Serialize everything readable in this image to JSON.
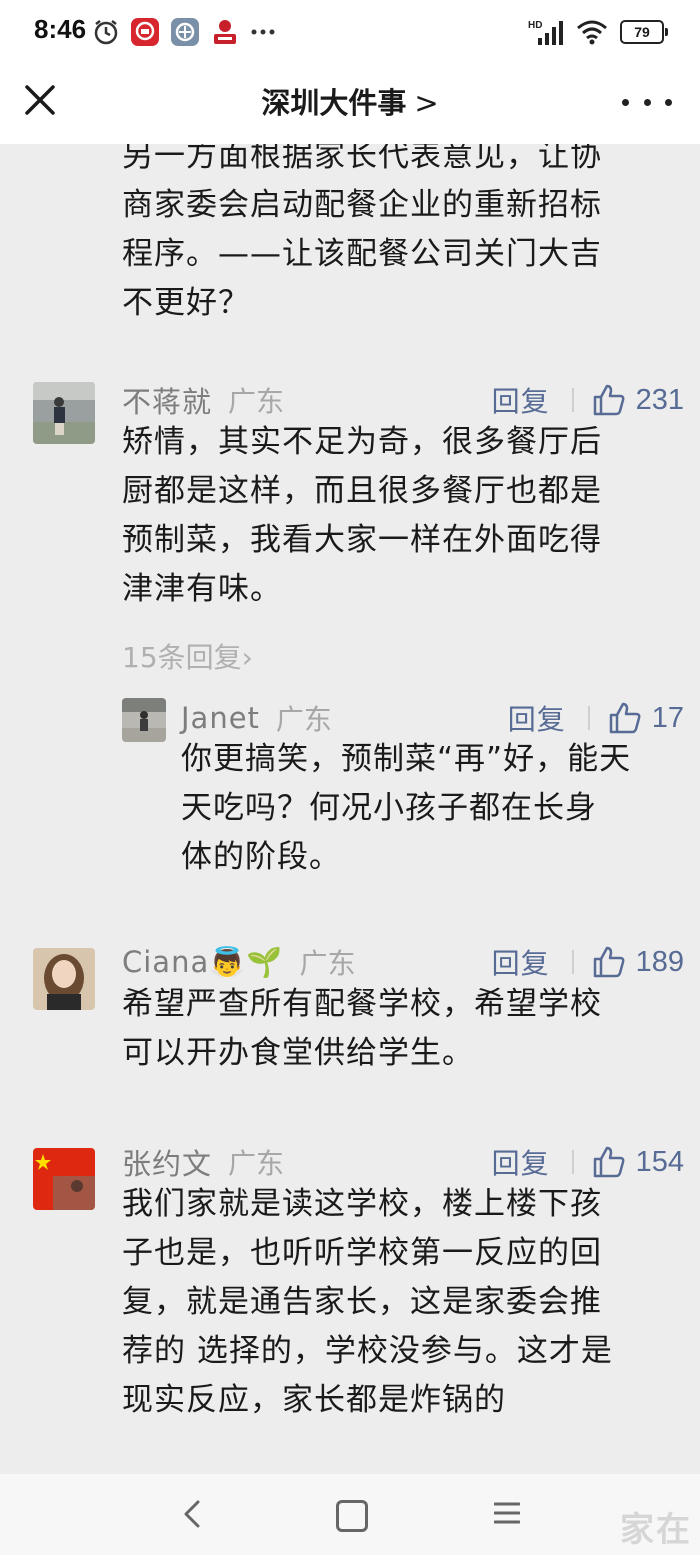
{
  "status_bar": {
    "time": "8:46",
    "network": "HD",
    "battery": "79"
  },
  "nav": {
    "title": "深圳大件事",
    "chevron": ">"
  },
  "previous_comment": {
    "lines": [
      "另一方面根据家长代表意见，让协",
      "商家委会启动配餐企业的重新招标",
      "程序。——让该配餐公司关门大吉",
      "不更好？"
    ]
  },
  "comments": [
    {
      "name": "不蒋就",
      "region": "广东",
      "reply_label": "回复",
      "likes": "231",
      "lines": [
        "矫情，其实不足为奇，很多餐厅后",
        "厨都是这样，而且很多餐厅也都是",
        "预制菜，我看大家一样在外面吃得",
        "津津有味。"
      ],
      "more_replies": "15条回复",
      "reply": {
        "name": "Janet",
        "region": "广东",
        "reply_label": "回复",
        "likes": "17",
        "lines": [
          "你更搞笑，预制菜“再”好，能天",
          "天吃吗？何况小孩子都在长身",
          "体的阶段。"
        ]
      }
    },
    {
      "name": "Ciana",
      "name_emoji": "👼🌱",
      "region": "广东",
      "reply_label": "回复",
      "likes": "189",
      "lines": [
        "希望严查所有配餐学校，希望学校",
        "可以开办食堂供给学生。"
      ]
    },
    {
      "name": "张约文",
      "region": "广东",
      "reply_label": "回复",
      "likes": "154",
      "lines": [
        "我们家就是读这学校，楼上楼下孩",
        "子也是，也听听学校第一反应的回",
        "复，就是通告家长，这是家委会推",
        "荐的 选择的，学校没参与。这才是",
        "现实反应，家长都是炸锅的"
      ]
    }
  ],
  "watermark": "家在"
}
